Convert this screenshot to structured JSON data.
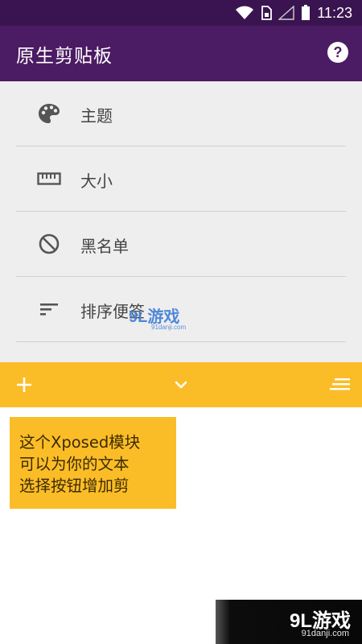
{
  "status_bar": {
    "time": "11:23",
    "icons": [
      "wifi-icon",
      "sim-card-icon",
      "signal-icon",
      "battery-icon"
    ]
  },
  "app_bar": {
    "title": "原生剪贴板",
    "help_icon": "help-circle-icon",
    "help_glyph": "?"
  },
  "menu": {
    "items": [
      {
        "label": "主题",
        "icon": "palette-icon"
      },
      {
        "label": "大小",
        "icon": "ruler-icon"
      },
      {
        "label": "黑名单",
        "icon": "block-icon"
      },
      {
        "label": "排序便签",
        "icon": "sort-icon"
      }
    ]
  },
  "toolbar": {
    "add_icon": "plus-icon",
    "expand_icon": "chevron-down-icon",
    "sort_icon": "sort-lines-icon"
  },
  "tooltip": {
    "lines": [
      "这个Xposed模块",
      "可以为你的文本",
      "选择按钮增加剪"
    ]
  },
  "watermark": {
    "logo_text": "9L游戏",
    "url": "91danji.com",
    "mid_logo": "9L游戏",
    "mid_url": "91danji.com"
  },
  "colors": {
    "status_bar": "#3a1450",
    "app_bar": "#4b1b63",
    "accent": "#fbbd27",
    "menu_bg": "#eeeeee"
  }
}
